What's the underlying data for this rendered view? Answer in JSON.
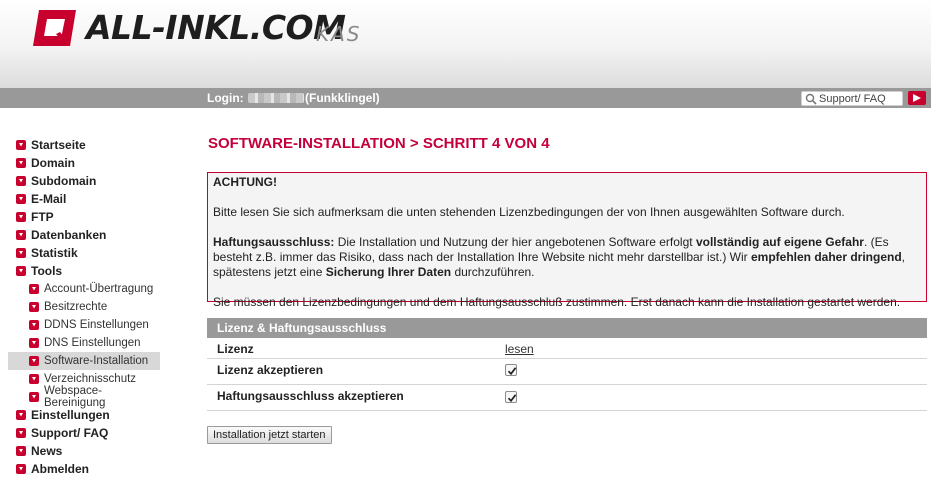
{
  "header": {
    "logo_text": "ALL-INKL.COM",
    "logo_suffix": "KAS",
    "brand_color": "#c8002e"
  },
  "topbar": {
    "login_label": "Login:",
    "login_suffix": "(Funkklingel)",
    "search_value": "Support/ FAQ"
  },
  "nav": {
    "items": [
      {
        "label": "Startseite",
        "level": "main"
      },
      {
        "label": "Domain",
        "level": "main"
      },
      {
        "label": "Subdomain",
        "level": "main"
      },
      {
        "label": "E-Mail",
        "level": "main"
      },
      {
        "label": "FTP",
        "level": "main"
      },
      {
        "label": "Datenbanken",
        "level": "main"
      },
      {
        "label": "Statistik",
        "level": "main"
      },
      {
        "label": "Tools",
        "level": "main"
      },
      {
        "label": "Account-Übertragung",
        "level": "sub"
      },
      {
        "label": "Besitzrechte",
        "level": "sub"
      },
      {
        "label": "DDNS Einstellungen",
        "level": "sub"
      },
      {
        "label": "DNS Einstellungen",
        "level": "sub"
      },
      {
        "label": "Software-Installation",
        "level": "sub",
        "active": true
      },
      {
        "label": "Verzeichnisschutz",
        "level": "sub"
      },
      {
        "label": "Webspace-Bereinigung",
        "level": "sub"
      },
      {
        "label": "Einstellungen",
        "level": "main"
      },
      {
        "label": "Support/ FAQ",
        "level": "main"
      },
      {
        "label": "News",
        "level": "main"
      },
      {
        "label": "Abmelden",
        "level": "main"
      }
    ]
  },
  "main": {
    "title": "SOFTWARE-INSTALLATION > SCHRITT 4 VON 4",
    "warning": {
      "heading": "ACHTUNG!",
      "p1": "Bitte lesen Sie sich aufmerksam die unten stehenden Lizenzbedingungen der von Ihnen ausgewählten Software durch.",
      "p2_b1": "Haftungsausschluss:",
      "p2_t1": " Die Installation und Nutzung der hier angebotenen Software erfolgt ",
      "p2_b2": "vollständig auf eigene Gefahr",
      "p2_t2": ". (Es besteht z.B. immer das Risiko, dass nach der Installation Ihre Website nicht mehr darstellbar ist.) Wir ",
      "p2_b3": "empfehlen daher dringend",
      "p2_t3": ", spätestens jetzt eine ",
      "p2_b4": "Sicherung Ihrer Daten",
      "p2_t4": " durchzuführen.",
      "p3": "Sie müssen den Lizenzbedingungen und dem Haftungsausschluß zustimmen. Erst danach kann die Installation gestartet werden."
    },
    "table": {
      "heading": "Lizenz & Haftungsausschluss",
      "row_lizenz_label": "Lizenz",
      "row_lizenz_link": "lesen",
      "row_accept_license_label": "Lizenz akzeptieren",
      "row_accept_license_checked": true,
      "row_accept_liability_label": "Haftungsausschluss akzeptieren",
      "row_accept_liability_checked": true
    },
    "start_button": "Installation jetzt starten"
  }
}
